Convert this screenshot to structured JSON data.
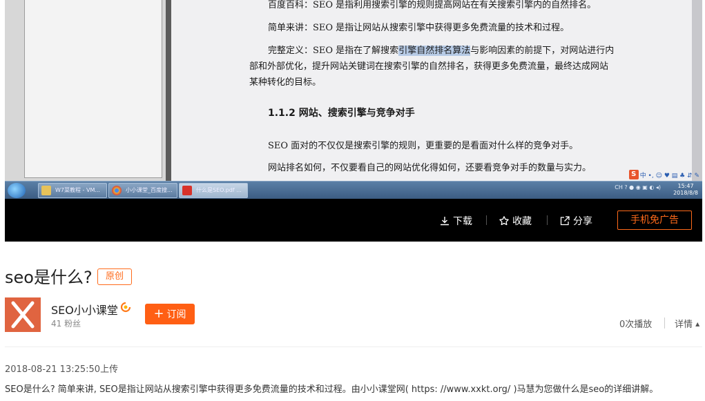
{
  "video": {
    "document": {
      "lines": [
        "百度百科：SEO 是指利用搜索引擎的规则提高网站在有关搜索引擎内的自然排名。",
        "简单来讲：SEO 是指让网站从搜索引擎中获得更多免费流量的技术和过程。",
        "完整定义：SEO 是指在了解搜索",
        "引擎自然排名算法",
        "与影响因素的前提下，对网站进行内",
        "部和外部优化，提升网站关键词在搜索引擎的自然排名，获得更多免费流量，最终达成网站",
        "某种转化的目标。",
        "SEO 面对的不仅仅是搜索引擎的规则，更重要的是看面对什么样的竞争对手。",
        "网站排名如何，不仅要看自己的网站优化得如何，还要看竞争对手的数量与实力。"
      ],
      "heading": "1.1.2  网站、搜索引擎与竞争对手"
    },
    "ime": {
      "logo": "S",
      "text": "中 •, ☺ ♥ ▤ ♣ ⇵ ✎"
    },
    "taskbar": {
      "items": [
        "W7菜教程 - VM...",
        "小小课堂_百度搜...",
        "什么是SEO.pdf ..."
      ],
      "tray_text": "CH ? ● ◉ ▣ ◐ ◂)",
      "time": "15:47",
      "date": "2018/8/8"
    },
    "controls": {
      "download": "下载",
      "favorite": "收藏",
      "share": "分享",
      "ad_free": "手机免广告"
    }
  },
  "info": {
    "title": "seo是什么?",
    "badge": "原创",
    "uploader": {
      "name": "SEO小小课堂",
      "fans": "41 粉丝"
    },
    "subscribe": "订阅",
    "plays": "0次播放",
    "detail": "详情",
    "upload_time": "2018-08-21 13:25:50上传",
    "description": "SEO是什么? 简单来讲, SEO是指让网站从搜索引擎中获得更多免费流量的技术和过程。由小小课堂网( https: //www.xxkt.org/ )马慧为您做什么是seo的详细讲解。"
  },
  "colors": {
    "accent": "#ff5f14",
    "avatar": "#e06440"
  }
}
